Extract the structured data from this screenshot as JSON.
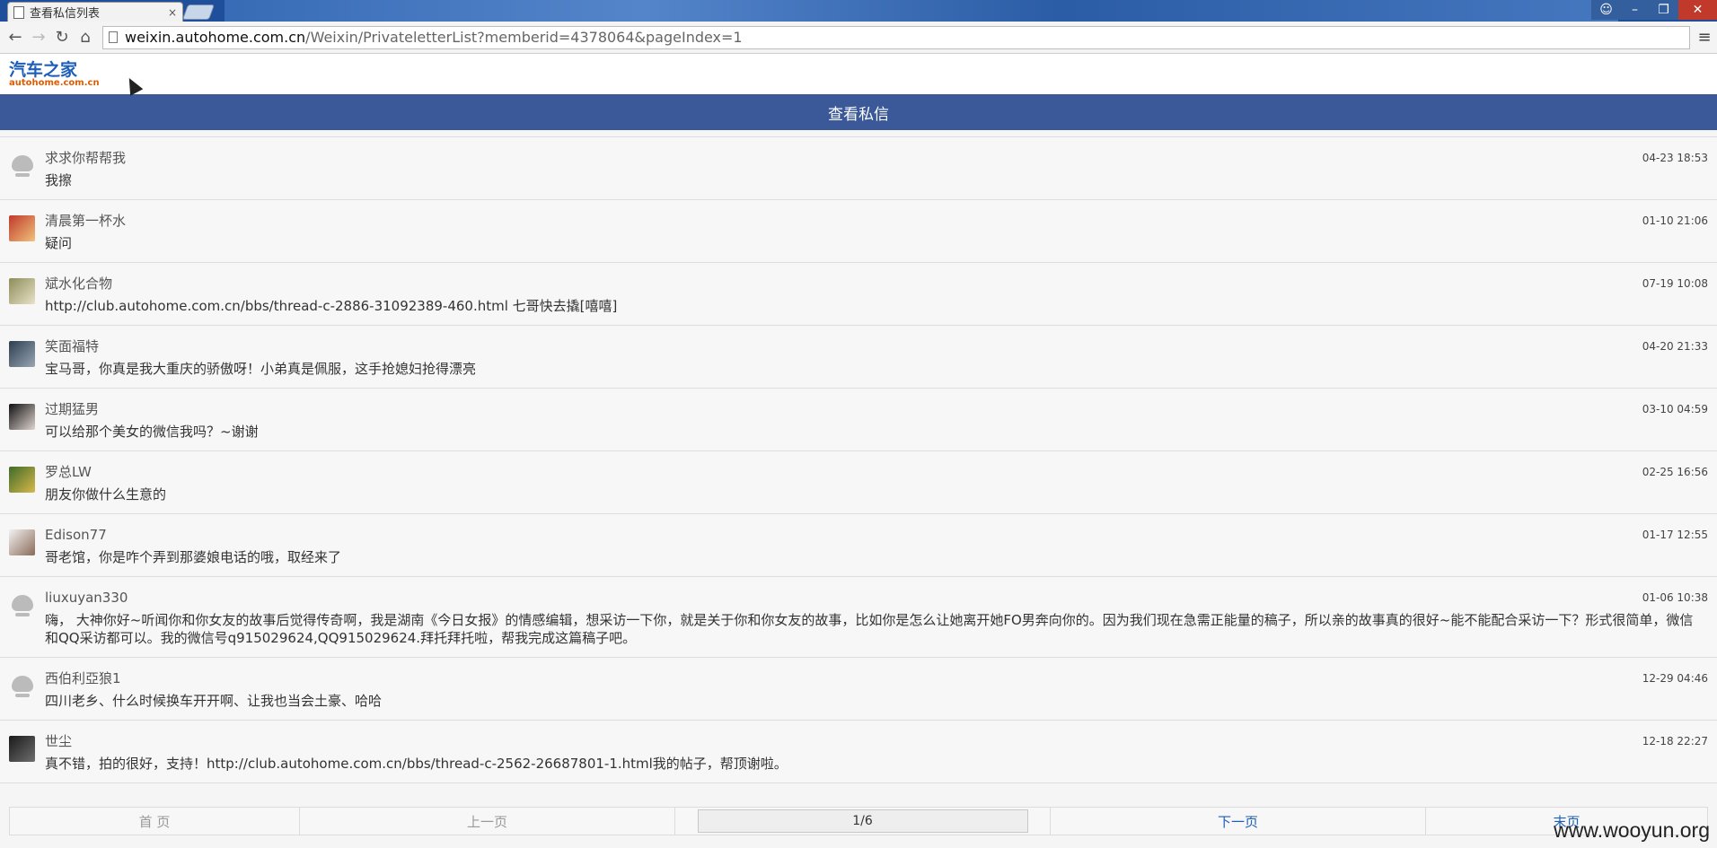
{
  "browser": {
    "tab_title": "查看私信列表",
    "tab_close": "×",
    "url_host": "weixin.autohome.com.cn",
    "url_path": "/Weixin/PrivateletterList?memberid=4378064&pageIndex=1"
  },
  "logo": {
    "cn": "汽车之家",
    "en": "autohome.com.cn"
  },
  "header": {
    "title": "查看私信"
  },
  "messages": [
    {
      "name": "求求你帮帮我",
      "text": "我擦",
      "time": "04-23 18:53",
      "avatar": "default"
    },
    {
      "name": "清晨第一杯水",
      "text": "疑问",
      "time": "01-10 21:06",
      "avatar": "photo",
      "c1": "#c0392b",
      "c2": "#f0c27b"
    },
    {
      "name": "斌水化合物",
      "text": "http://club.autohome.com.cn/bbs/thread-c-2886-31092389-460.html 七哥快去撬[嘻嘻]",
      "time": "07-19 10:08",
      "avatar": "photo",
      "c1": "#8d8d5a",
      "c2": "#e8e2c8"
    },
    {
      "name": "笑面福特",
      "text": "宝马哥，你真是我大重庆的骄傲呀！小弟真是佩服，这手抢媳妇抢得漂亮",
      "time": "04-20 21:33",
      "avatar": "photo",
      "c1": "#2d3e50",
      "c2": "#9aa7b3"
    },
    {
      "name": "过期猛男",
      "text": "可以给那个美女的微信我吗？~谢谢",
      "time": "03-10 04:59",
      "avatar": "photo",
      "c1": "#111111",
      "c2": "#e0d5d0"
    },
    {
      "name": "罗总LW",
      "text": "朋友你做什么生意的",
      "time": "02-25 16:56",
      "avatar": "photo",
      "c1": "#3f6b2a",
      "c2": "#d9b84a"
    },
    {
      "name": "Edison77",
      "text": "哥老馆，你是咋个弄到那婆娘电话的哦，取经来了",
      "time": "01-17 12:55",
      "avatar": "photo",
      "c1": "#f2f2f2",
      "c2": "#8a6a58"
    },
    {
      "name": "liuxuyan330",
      "text": "嗨， 大神你好~听闻你和你女友的故事后觉得传奇啊，我是湖南《今日女报》的情感编辑，想采访一下你，就是关于你和你女友的故事，比如你是怎么让她离开她FO男奔向你的。因为我们现在急需正能量的稿子，所以亲的故事真的很好~能不能配合采访一下？形式很简单，微信和QQ采访都可以。我的微信号q915029624,QQ915029624.拜托拜托啦，帮我完成这篇稿子吧。",
      "time": "01-06 10:38",
      "avatar": "default"
    },
    {
      "name": "西伯利亞狼1",
      "text": "四川老乡、什么时候换车开开啊、让我也当会土豪、哈哈",
      "time": "12-29 04:46",
      "avatar": "default"
    },
    {
      "name": "世尘",
      "text": "真不错，拍的很好，支持！http://club.autohome.com.cn/bbs/thread-c-2562-26687801-1.html我的帖子，帮顶谢啦。",
      "time": "12-18 22:27",
      "avatar": "photo",
      "c1": "#1a1a1a",
      "c2": "#6e6e6e"
    }
  ],
  "pager": {
    "first": "首 页",
    "prev": "上一页",
    "current": "1/6",
    "next": "下一页",
    "last": "末页"
  },
  "watermark": "www.wooyun.org"
}
